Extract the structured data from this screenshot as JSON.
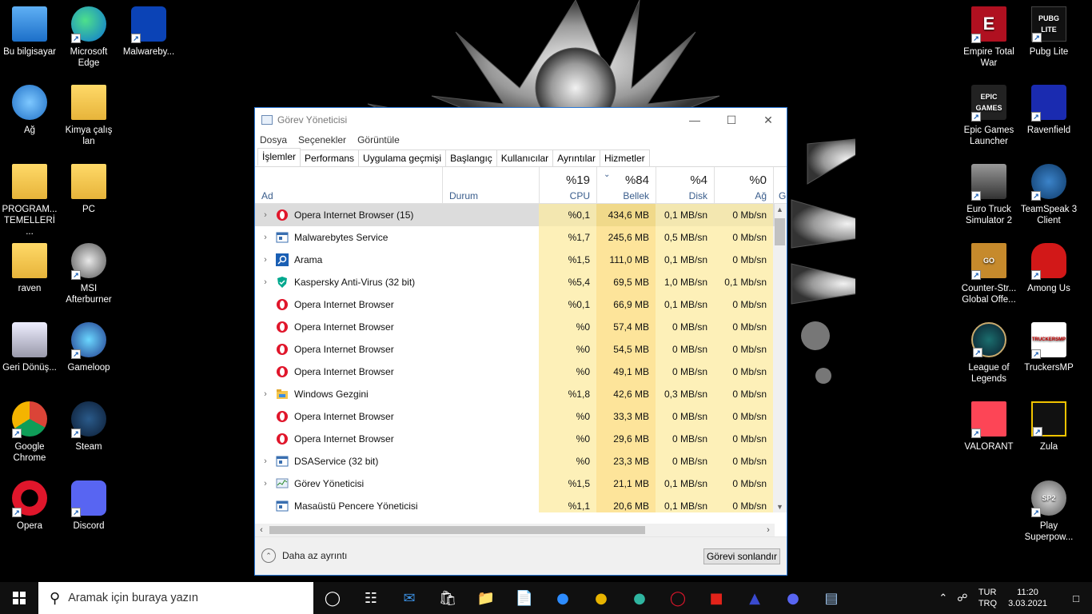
{
  "desktop": {
    "left_icons": [
      {
        "label": "Bu bilgisayar",
        "icon": "computer-icon"
      },
      {
        "label": "Microsoft Edge",
        "icon": "edge-icon"
      },
      {
        "label": "Malwareby...",
        "icon": "malwarebytes-icon"
      },
      {
        "label": "Ağ",
        "icon": "network-icon"
      },
      {
        "label": "Kimya çalış lan",
        "icon": "folder-icon"
      },
      {
        "label": "PROGRAM... TEMELLERİ ...",
        "icon": "folder-icon"
      },
      {
        "label": "PC",
        "icon": "folder-icon"
      },
      {
        "label": "raven",
        "icon": "folder-icon"
      },
      {
        "label": "MSI Afterburner",
        "icon": "msi-afterburner-icon"
      },
      {
        "label": "Geri Dönüş...",
        "icon": "recycle-bin-icon"
      },
      {
        "label": "Gameloop",
        "icon": "gameloop-icon"
      },
      {
        "label": "Google Chrome",
        "icon": "chrome-icon"
      },
      {
        "label": "Steam",
        "icon": "steam-icon"
      },
      {
        "label": "Opera",
        "icon": "opera-icon"
      },
      {
        "label": "Discord",
        "icon": "discord-icon"
      }
    ],
    "right_icons": [
      {
        "label": "Empire Total War",
        "icon": "empire-total-war-icon"
      },
      {
        "label": "Pubg Lite",
        "icon": "pubg-lite-icon"
      },
      {
        "label": "Epic Games Launcher",
        "icon": "epic-games-icon"
      },
      {
        "label": "Ravenfield",
        "icon": "ravenfield-icon"
      },
      {
        "label": "Euro Truck Simulator 2",
        "icon": "euro-truck-icon"
      },
      {
        "label": "TeamSpeak 3 Client",
        "icon": "teamspeak-icon"
      },
      {
        "label": "Counter-Str... Global Offe...",
        "icon": "csgo-icon"
      },
      {
        "label": "Among Us",
        "icon": "among-us-icon"
      },
      {
        "label": "League of Legends",
        "icon": "league-of-legends-icon"
      },
      {
        "label": "TruckersMP",
        "icon": "truckersmp-icon"
      },
      {
        "label": "VALORANT",
        "icon": "valorant-icon"
      },
      {
        "label": "Zula",
        "icon": "zula-icon"
      },
      {
        "label": "Play Superpow...",
        "icon": "superpower-icon"
      }
    ],
    "icon_texts": {
      "epic": "EPIC GAMES",
      "pubg": "PUBG LITE",
      "empire": "E",
      "csgo": "GO",
      "sp2": "SP2",
      "truckers": "TRUCKERSMP"
    }
  },
  "taskmanager": {
    "title": "Görev Yöneticisi",
    "menu": [
      "Dosya",
      "Seçenekler",
      "Görüntüle"
    ],
    "tabs": [
      "İşlemler",
      "Performans",
      "Uygulama geçmişi",
      "Başlangıç",
      "Kullanıcılar",
      "Ayrıntılar",
      "Hizmetler"
    ],
    "columns": {
      "name": "Ad",
      "status": "Durum",
      "cpu_pct": "%19",
      "cpu": "CPU",
      "mem_pct": "%84",
      "mem": "Bellek",
      "disk_pct": "%4",
      "disk": "Disk",
      "net_pct": "%0",
      "net": "Ağ",
      "gpu_partial": "G"
    },
    "processes": [
      {
        "name": "Opera Internet Browser (15)",
        "icon": "opera",
        "expand": true,
        "cpu": "%0,1",
        "mem": "434,6 MB",
        "disk": "0,1 MB/sn",
        "net": "0 Mb/sn",
        "selected": true
      },
      {
        "name": "Malwarebytes Service",
        "icon": "service",
        "expand": true,
        "cpu": "%1,7",
        "mem": "245,6 MB",
        "disk": "0,5 MB/sn",
        "net": "0 Mb/sn"
      },
      {
        "name": "Arama",
        "icon": "search",
        "expand": true,
        "cpu": "%1,5",
        "mem": "111,0 MB",
        "disk": "0,1 MB/sn",
        "net": "0 Mb/sn"
      },
      {
        "name": "Kaspersky Anti-Virus (32 bit)",
        "icon": "kaspersky",
        "expand": true,
        "cpu": "%5,4",
        "mem": "69,5 MB",
        "disk": "1,0 MB/sn",
        "net": "0,1 Mb/sn"
      },
      {
        "name": "Opera Internet Browser",
        "icon": "opera",
        "expand": false,
        "cpu": "%0,1",
        "mem": "66,9 MB",
        "disk": "0,1 MB/sn",
        "net": "0 Mb/sn"
      },
      {
        "name": "Opera Internet Browser",
        "icon": "opera",
        "expand": false,
        "cpu": "%0",
        "mem": "57,4 MB",
        "disk": "0 MB/sn",
        "net": "0 Mb/sn"
      },
      {
        "name": "Opera Internet Browser",
        "icon": "opera",
        "expand": false,
        "cpu": "%0",
        "mem": "54,5 MB",
        "disk": "0 MB/sn",
        "net": "0 Mb/sn"
      },
      {
        "name": "Opera Internet Browser",
        "icon": "opera",
        "expand": false,
        "cpu": "%0",
        "mem": "49,1 MB",
        "disk": "0 MB/sn",
        "net": "0 Mb/sn"
      },
      {
        "name": "Windows Gezgini",
        "icon": "explorer",
        "expand": true,
        "cpu": "%1,8",
        "mem": "42,6 MB",
        "disk": "0,3 MB/sn",
        "net": "0 Mb/sn"
      },
      {
        "name": "Opera Internet Browser",
        "icon": "opera",
        "expand": false,
        "cpu": "%0",
        "mem": "33,3 MB",
        "disk": "0 MB/sn",
        "net": "0 Mb/sn"
      },
      {
        "name": "Opera Internet Browser",
        "icon": "opera",
        "expand": false,
        "cpu": "%0",
        "mem": "29,6 MB",
        "disk": "0 MB/sn",
        "net": "0 Mb/sn"
      },
      {
        "name": "DSAService (32 bit)",
        "icon": "service",
        "expand": true,
        "cpu": "%0",
        "mem": "23,3 MB",
        "disk": "0 MB/sn",
        "net": "0 Mb/sn"
      },
      {
        "name": "Görev Yöneticisi",
        "icon": "taskmgr",
        "expand": true,
        "cpu": "%1,5",
        "mem": "21,1 MB",
        "disk": "0,1 MB/sn",
        "net": "0 Mb/sn"
      },
      {
        "name": "Masaüstü Pencere Yöneticisi",
        "icon": "service",
        "expand": false,
        "cpu": "%1,1",
        "mem": "20,6 MB",
        "disk": "0,1 MB/sn",
        "net": "0 Mb/sn"
      }
    ],
    "fewer_details": "Daha az ayrıntı",
    "end_task": "Görevi sonlandır"
  },
  "taskbar": {
    "search_placeholder": "Aramak için buraya yazın",
    "pinned": [
      "cortana-icon",
      "task-view-icon",
      "mail-icon",
      "store-icon",
      "file-explorer-icon",
      "file-icon",
      "zoom-icon",
      "chrome-icon",
      "edge-icon",
      "opera-icon",
      "roblox-icon",
      "ravenfield-icon",
      "discord-icon",
      "task-manager-icon"
    ],
    "lang_top": "TUR",
    "lang_bottom": "TRQ",
    "time": "11:20",
    "date": "3.03.2021"
  },
  "colors": {
    "cpu_heat": "#fdf0b8",
    "mem_heat": "#fde49a",
    "accent": "#2b79d8"
  }
}
